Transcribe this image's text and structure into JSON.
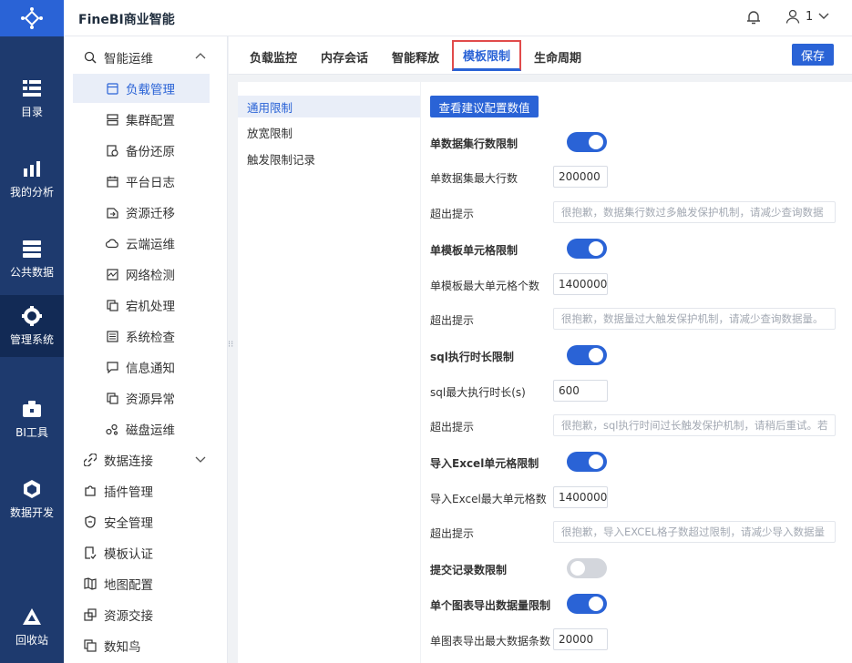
{
  "app": {
    "title": "FineBI商业智能",
    "user": "1"
  },
  "rail": [
    {
      "label": "目录",
      "icon": "catalog-icon"
    },
    {
      "label": "我的分析",
      "icon": "analysis-icon"
    },
    {
      "label": "公共数据",
      "icon": "public-data-icon"
    },
    {
      "label": "管理系统",
      "icon": "management-icon",
      "active": true
    },
    {
      "label": "BI工具",
      "icon": "toolbox-icon"
    },
    {
      "label": "数据开发",
      "icon": "data-dev-icon"
    },
    {
      "label": "回收站",
      "icon": "recycle-bin-icon"
    }
  ],
  "subnav": {
    "group_ops": "智能运维",
    "items": [
      "负载管理",
      "集群配置",
      "备份还原",
      "平台日志",
      "资源迁移",
      "云端运维",
      "网络检测",
      "宕机处理",
      "系统检查",
      "信息通知",
      "资源异常",
      "磁盘运维"
    ],
    "groups": [
      "数据连接",
      "插件管理",
      "安全管理",
      "模板认证",
      "地图配置",
      "资源交接",
      "数知鸟"
    ]
  },
  "tabs": [
    "负载监控",
    "内存会话",
    "智能释放",
    "模板限制",
    "生命周期"
  ],
  "save_label": "保存",
  "limits": [
    "通用限制",
    "放宽限制",
    "触发限制记录"
  ],
  "suggest_label": "查看建议配置数值",
  "form": {
    "ds_rows_title": "单数据集行数限制",
    "ds_rows_max_label": "单数据集最大行数",
    "ds_rows_max": "200000",
    "over_tip_label": "超出提示",
    "ds_rows_tip": "很抱歉，数据集行数过多触发保护机制，请减少查询数据",
    "cells_title": "单模板单元格限制",
    "cells_max_label": "单模板最大单元格个数",
    "cells_max": "1400000",
    "cells_tip": "很抱歉，数据量过大触发保护机制，请减少查询数据量。",
    "sql_title": "sql执行时长限制",
    "sql_max_label": "sql最大执行时长(s)",
    "sql_max": "600",
    "sql_tip": "很抱歉，sql执行时间过长触发保护机制，请稍后重试。若",
    "excel_title": "导入Excel单元格限制",
    "excel_max_label": "导入Excel最大单元格数",
    "excel_max": "1400000",
    "excel_tip": "很抱歉，导入EXCEL格子数超过限制，请减少导入数据量",
    "submit_title": "提交记录数限制",
    "export_title": "单个图表导出数据量限制",
    "export_max_label": "单图表导出最大数据条数",
    "export_max": "20000"
  }
}
